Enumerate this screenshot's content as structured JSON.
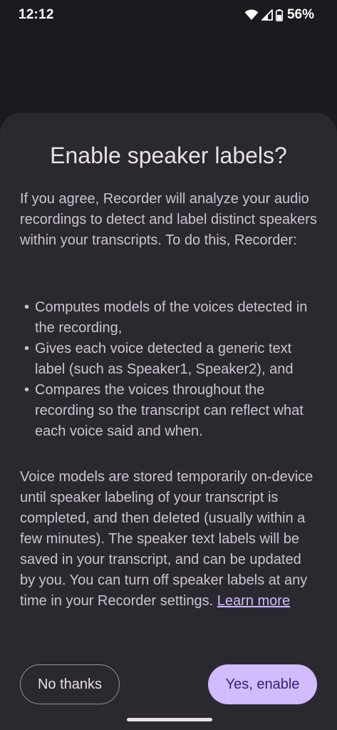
{
  "status_bar": {
    "time": "12:12",
    "battery_percent": "56%",
    "icons": [
      "wifi-icon",
      "signal-icon",
      "battery-icon"
    ]
  },
  "dialog": {
    "title": "Enable speaker labels?",
    "intro": "If you agree, Recorder will analyze your audio recordings to detect and label distinct speakers within your transcripts. To do this, Recorder:",
    "bullets": [
      "Computes models of the voices detected in the recording,",
      "Gives each voice detected a generic text label (such as Speaker1, Speaker2), and",
      "Compares the voices throughout the recording so the transcript can reflect what each voice said and when."
    ],
    "outro": "Voice models are stored temporarily on-device until speaker labeling of your transcript is completed, and then deleted (usually within a few minutes). The speaker text labels will be saved in your transcript, and can be updated by you. You can turn off speaker labels at any time in your Recorder settings.",
    "learn_more": "Learn more",
    "buttons": {
      "no_thanks": "No thanks",
      "yes_enable": "Yes, enable"
    }
  },
  "colors": {
    "background": "#1b1a1f",
    "sheet": "#2b2930",
    "primary": "#d0bcff",
    "on_primary": "#381e72"
  }
}
